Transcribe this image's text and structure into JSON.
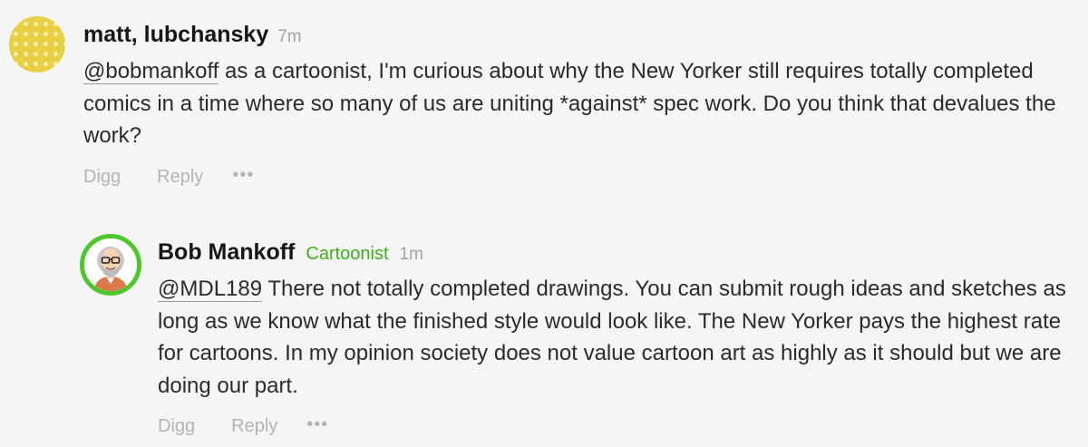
{
  "comments": [
    {
      "author": "matt, lubchansky",
      "time": "7m",
      "mention": "@bobmankoff",
      "text": " as a cartoonist, I'm curious about why the New Yorker still requires totally completed comics in a time where so many of us are uniting *against* spec work. Do you think that devalues the work?",
      "actions": {
        "digg": "Digg",
        "reply": "Reply",
        "more": "•••"
      },
      "avatar_colors": {
        "background": "#e8cf44",
        "dots": "#fbf1b8"
      }
    },
    {
      "author": "Bob Mankoff",
      "role": "Cartoonist",
      "time": "1m",
      "mention": "@MDL189",
      "text": " There not totally completed drawings. You can submit rough ideas and sketches as long as we know what the finished style would look like. The New Yorker pays the highest rate for cartoons. In my opinion society does not value cartoon art as highly as it should but we are doing our part.",
      "actions": {
        "digg": "Digg",
        "reply": "Reply",
        "more": "•••"
      },
      "avatar_colors": {
        "ring": "#4ec72a"
      }
    }
  ],
  "colors": {
    "page_background": "#f5f5f5",
    "role_green": "#3fae1c",
    "muted_text": "#b4b4b4"
  }
}
